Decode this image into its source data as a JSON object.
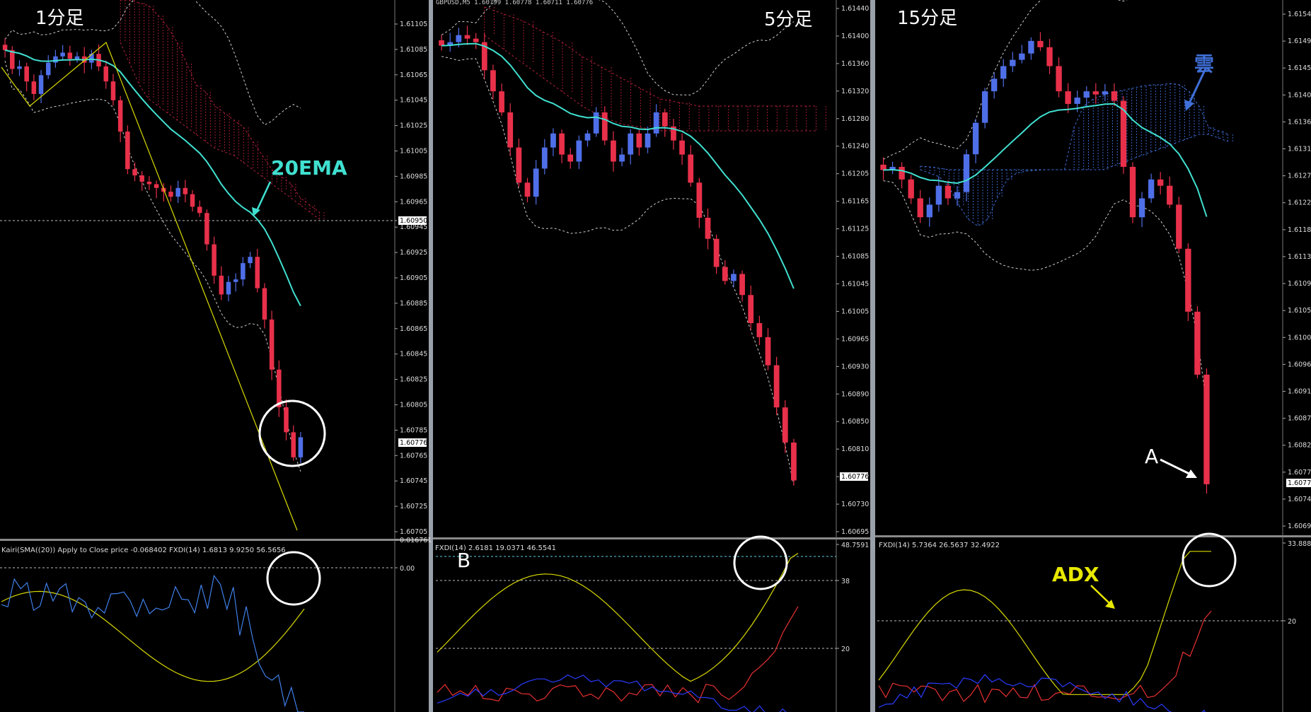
{
  "colors": {
    "bg": "#000000",
    "bull": "#4f6fe8",
    "bear": "#e8304a",
    "ema": "#40e0d0",
    "adx": "#d9d900",
    "white": "#ffffff",
    "cloud_red": "#b0203a",
    "cloud_blue": "#3f6fd8",
    "grid": "#8a8a8a",
    "separator": "#9aa0aa",
    "plus_di": "#e83030",
    "minus_di": "#2a3cff"
  },
  "panels": [
    {
      "title": "1分足",
      "price_ticks": [
        "1.61105",
        "1.61085",
        "1.61065",
        "1.61045",
        "1.61025",
        "1.61005",
        "1.60985",
        "1.60965",
        "1.60945",
        "1.60925",
        "1.60905",
        "1.60885",
        "1.60865",
        "1.60845",
        "1.60825",
        "1.60805",
        "1.60785",
        "1.60765",
        "1.60745",
        "1.60725",
        "1.60705"
      ],
      "price_marks": [
        "1.60950",
        "1.60776"
      ],
      "indicator_label": "Kairi(SMA((20)) Apply to Close price -0.068402  FXDI(14) 1.6813 9.9250 56.5656",
      "indicator_ticks": [
        "0.016761",
        "0.00"
      ],
      "annotations": [
        "20EMA"
      ]
    },
    {
      "title": "5分足",
      "symbol_line": "GBPUSD,M5  1.60799 1.60778 1.60711 1.60776",
      "price_ticks": [
        "1.61440",
        "1.61400",
        "1.61360",
        "1.61320",
        "1.61280",
        "1.61240",
        "1.61205",
        "1.61165",
        "1.61125",
        "1.61085",
        "1.61045",
        "1.61005",
        "1.60965",
        "1.60930",
        "1.60890",
        "1.60850",
        "1.60810",
        "1.60770",
        "1.60730",
        "1.60695"
      ],
      "price_marks": [
        "1.60776"
      ],
      "indicator_label": "FXDI(14) 2.6181 19.0371 46.5541",
      "indicator_ticks": [
        "48.7591",
        "38",
        "20"
      ],
      "annotations": [
        "B"
      ]
    },
    {
      "title": "15分足",
      "price_ticks": [
        "1.61540",
        "1.61495",
        "1.61450",
        "1.61405",
        "1.61360",
        "1.61315",
        "1.61270",
        "1.61225",
        "1.61180",
        "1.61135",
        "1.61095",
        "1.61050",
        "1.61005",
        "1.60960",
        "1.60915",
        "1.60870",
        "1.60825",
        "1.60776",
        "1.60740",
        "1.60695"
      ],
      "price_marks": [
        "1.60776"
      ],
      "indicator_label": "FXDI(14) 5.7364 26.5637 32.4922",
      "indicator_ticks": [
        "33.8882",
        "20"
      ],
      "annotations": [
        "雲",
        "ADX",
        "A"
      ]
    }
  ],
  "chart_data": [
    {
      "type": "candlestick",
      "title": "1分足",
      "ylim": [
        1.60695,
        1.61125
      ],
      "closes": [
        1.61085,
        1.6107,
        1.61072,
        1.6106,
        1.6105,
        1.61065,
        1.61075,
        1.6108,
        1.61083,
        1.61078,
        1.6108,
        1.61075,
        1.61082,
        1.61072,
        1.6106,
        1.61045,
        1.6102,
        1.6099,
        1.60985,
        1.6098,
        1.60978,
        1.60975,
        1.60972,
        1.60968,
        1.60975,
        1.6097,
        1.6096,
        1.60955,
        1.6093,
        1.60905,
        1.6089,
        1.609,
        1.60902,
        1.60915,
        1.6092,
        1.60895,
        1.6087,
        1.6083,
        1.608,
        1.6078,
        1.6076,
        1.60776
      ],
      "ema20_note": "20EMA",
      "indicator": {
        "kairi_last": -0.068402,
        "adx_last": 56.5656
      }
    },
    {
      "type": "candlestick",
      "title": "5分足",
      "ylim": [
        1.60695,
        1.6146
      ],
      "closes": [
        1.61395,
        1.614,
        1.6141,
        1.61405,
        1.614,
        1.6136,
        1.6133,
        1.613,
        1.6125,
        1.612,
        1.6118,
        1.6122,
        1.6125,
        1.6127,
        1.6124,
        1.6123,
        1.6126,
        1.6127,
        1.613,
        1.6126,
        1.6123,
        1.6124,
        1.6127,
        1.6125,
        1.6127,
        1.613,
        1.6128,
        1.6126,
        1.6124,
        1.612,
        1.6115,
        1.6112,
        1.6108,
        1.6106,
        1.6107,
        1.6104,
        1.61,
        1.6098,
        1.6094,
        1.6088,
        1.6083,
        1.60776
      ],
      "indicator": {
        "adx_last": 46.5541,
        "plus_di_last": 19.0371,
        "minus_di_last": 2.6181
      }
    },
    {
      "type": "candlestick",
      "title": "15分足",
      "ylim": [
        1.60695,
        1.61545
      ],
      "closes": [
        1.61275,
        1.6128,
        1.6126,
        1.6123,
        1.612,
        1.6122,
        1.6125,
        1.6123,
        1.6124,
        1.613,
        1.6135,
        1.614,
        1.6142,
        1.6144,
        1.6145,
        1.6146,
        1.6148,
        1.6147,
        1.6144,
        1.614,
        1.6138,
        1.6139,
        1.614,
        1.61395,
        1.614,
        1.61385,
        1.6128,
        1.612,
        1.6123,
        1.6126,
        1.6125,
        1.6122,
        1.6115,
        1.6105,
        1.6095,
        1.60776
      ],
      "indicator": {
        "adx_last": 32.4922,
        "plus_di_last": 26.5637,
        "minus_di_last": 5.7364
      }
    }
  ]
}
